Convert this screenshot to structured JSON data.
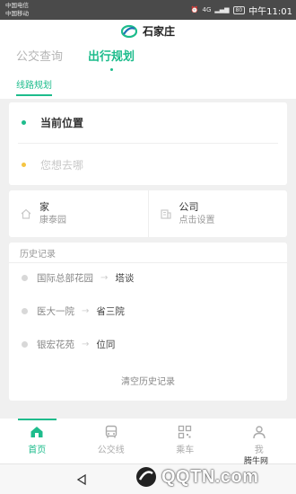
{
  "status": {
    "carrier_1": "中国电信",
    "carrier_2": "中国移动",
    "network": "4G",
    "battery": "80",
    "time": "中午11:01"
  },
  "header": {
    "city": "石家庄",
    "tabs": [
      {
        "label": "公交查询",
        "active": false
      },
      {
        "label": "出行规划",
        "active": true
      }
    ],
    "subtab": "线路规划"
  },
  "route": {
    "from_label": "当前位置",
    "to_placeholder": "您想去哪",
    "from_color": "#1ebc8c",
    "to_color": "#f5c542"
  },
  "places": {
    "home_title": "家",
    "home_sub": "康泰园",
    "work_title": "公司",
    "work_sub": "点击设置"
  },
  "history": {
    "title": "历史记录",
    "items": [
      {
        "from": "国际总部花园",
        "to": "塔谈"
      },
      {
        "from": "医大一院",
        "to": "省三院"
      },
      {
        "from": "银宏花苑",
        "to": "位同"
      }
    ],
    "clear": "清空历史记录"
  },
  "nav": {
    "items": [
      {
        "label": "首页",
        "icon": "home-icon",
        "active": true
      },
      {
        "label": "公交线",
        "icon": "bus-icon",
        "active": false
      },
      {
        "label": "乘车",
        "icon": "qr-code-icon",
        "active": false
      },
      {
        "label": "我",
        "icon": "person-icon",
        "active": false
      }
    ]
  },
  "watermark": {
    "logo": "QQTN.com",
    "text": "腾牛网"
  },
  "colors": {
    "accent": "#1ebc8c"
  }
}
